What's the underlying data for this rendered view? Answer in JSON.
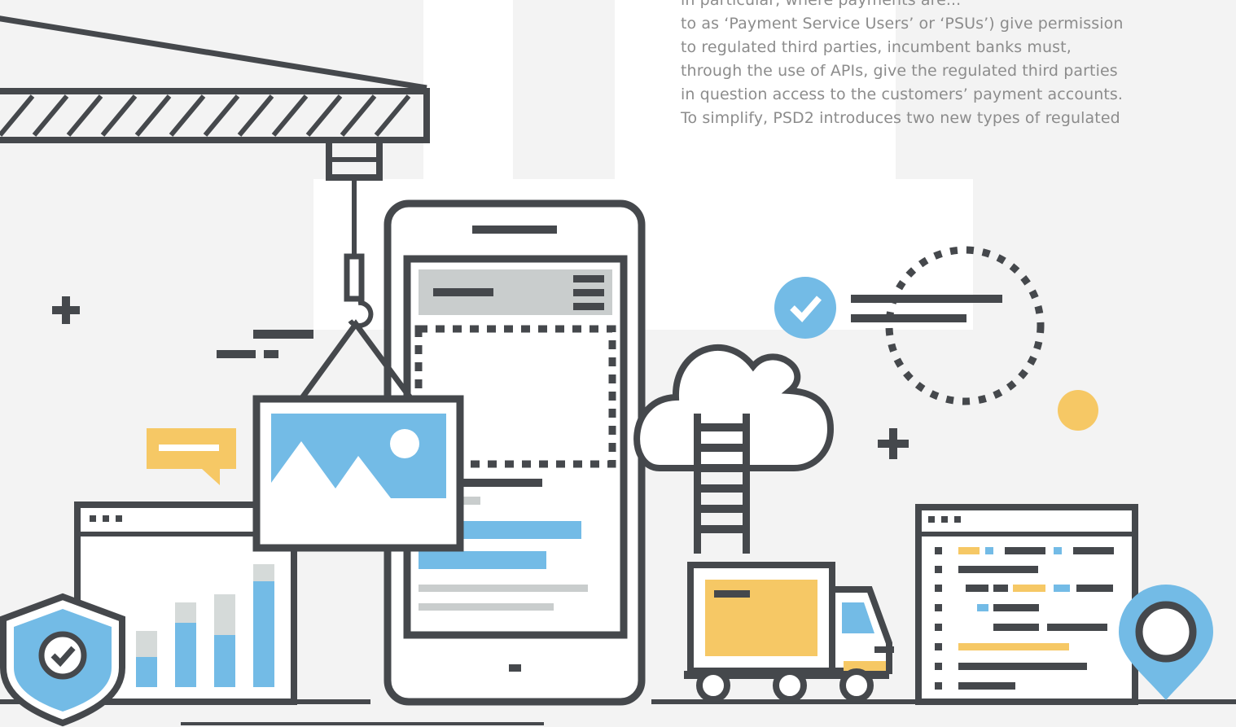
{
  "article": {
    "lines": [
      "in particular, where payments are...",
      "to as ‘Payment Service Users’ or ‘PSUs’) give permission",
      "to regulated third parties, incumbent banks must,",
      "through the use of APIs, give the regulated third parties",
      "in question access to the customers’ payment accounts.",
      "To simplify, PSD2 introduces two new types of regulated"
    ]
  },
  "icons": {
    "crane": "crane-icon",
    "phone": "smartphone-icon",
    "picture": "image-icon",
    "cloud": "cloud-icon",
    "truck": "truck-icon",
    "shield": "shield-check-icon",
    "pin": "location-pin-icon",
    "checkBadge": "check-circle-icon",
    "chat": "chat-bubble-icon",
    "timer": "dashed-circle-icon"
  },
  "colors": {
    "stroke": "#45484c",
    "blue": "#73bbe6",
    "yellow": "#f6c865",
    "grey": "#c9cdcd",
    "lightGrey": "#d5dad9",
    "background": "#f3f3f3",
    "white": "#ffffff",
    "text": "#8c8c8c"
  }
}
